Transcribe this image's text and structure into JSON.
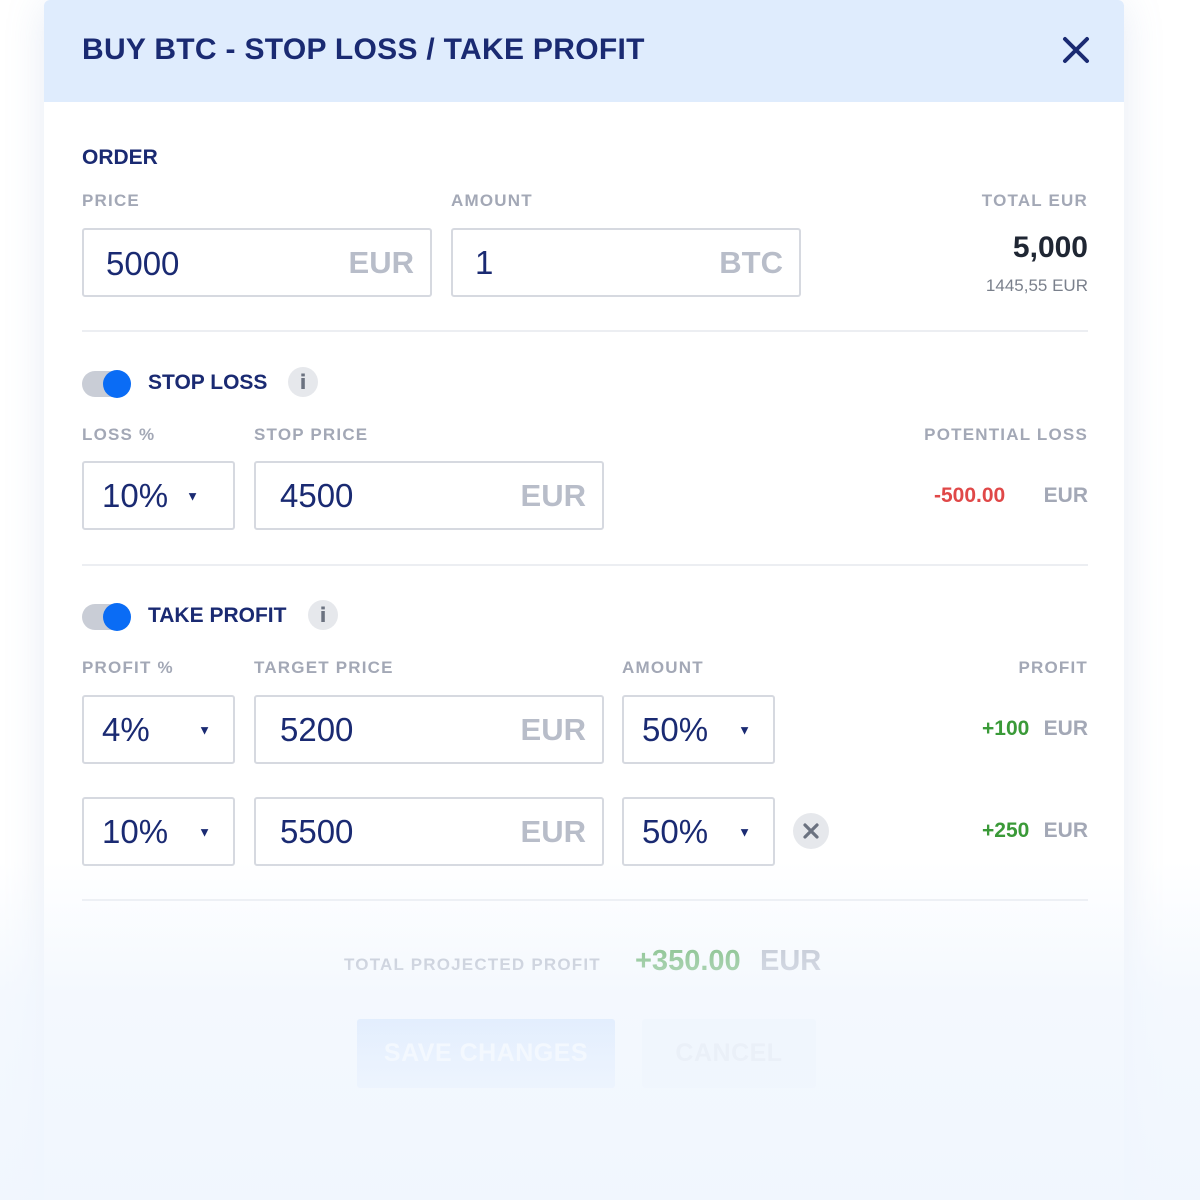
{
  "dialog": {
    "title": "BUY BTC - STOP LOSS / TAKE PROFIT"
  },
  "order": {
    "section_title": "ORDER",
    "price_label": "PRICE",
    "price_value": "5000",
    "price_unit": "EUR",
    "amount_label": "AMOUNT",
    "amount_value": "1",
    "amount_unit": "BTC",
    "total_label": "TOTAL EUR",
    "total_value": "5,000",
    "total_sub": "1445,55 EUR"
  },
  "stop_loss": {
    "label": "STOP LOSS",
    "enabled": true,
    "loss_label": "LOSS %",
    "loss_value": "10%",
    "stop_price_label": "STOP PRICE",
    "stop_price_value": "4500",
    "stop_price_unit": "EUR",
    "potential_loss_label": "POTENTIAL LOSS",
    "potential_loss_value": "-500.00",
    "potential_loss_unit": "EUR"
  },
  "take_profit": {
    "label": "TAKE PROFIT",
    "enabled": true,
    "profit_pct_label": "PROFIT %",
    "target_price_label": "TARGET PRICE",
    "amount_label": "AMOUNT",
    "profit_label": "PROFIT",
    "rows": [
      {
        "profit_pct": "4%",
        "target_price": "5200",
        "unit": "EUR",
        "amount": "50%",
        "profit": "+100",
        "profit_unit": "EUR"
      },
      {
        "profit_pct": "10%",
        "target_price": "5500",
        "unit": "EUR",
        "amount": "50%",
        "profit": "+250",
        "profit_unit": "EUR"
      }
    ]
  },
  "summary": {
    "total_projected_label": "TOTAL PROJECTED PROFIT",
    "total_projected_value": "+350.00",
    "total_projected_unit": "EUR"
  },
  "actions": {
    "save_label": "SAVE CHANGES",
    "cancel_label": "CANCEL"
  },
  "colors": {
    "header_bg": "#dfecfd",
    "primary_text": "#1a2a72",
    "accent_blue": "#0a6cf5",
    "loss_red": "#e04848",
    "profit_green": "#3a9a38",
    "muted_label": "#a3a8b6"
  },
  "icons": {
    "close": "close-icon",
    "info": "info-icon",
    "dropdown": "caret-down-icon",
    "remove": "remove-icon"
  }
}
